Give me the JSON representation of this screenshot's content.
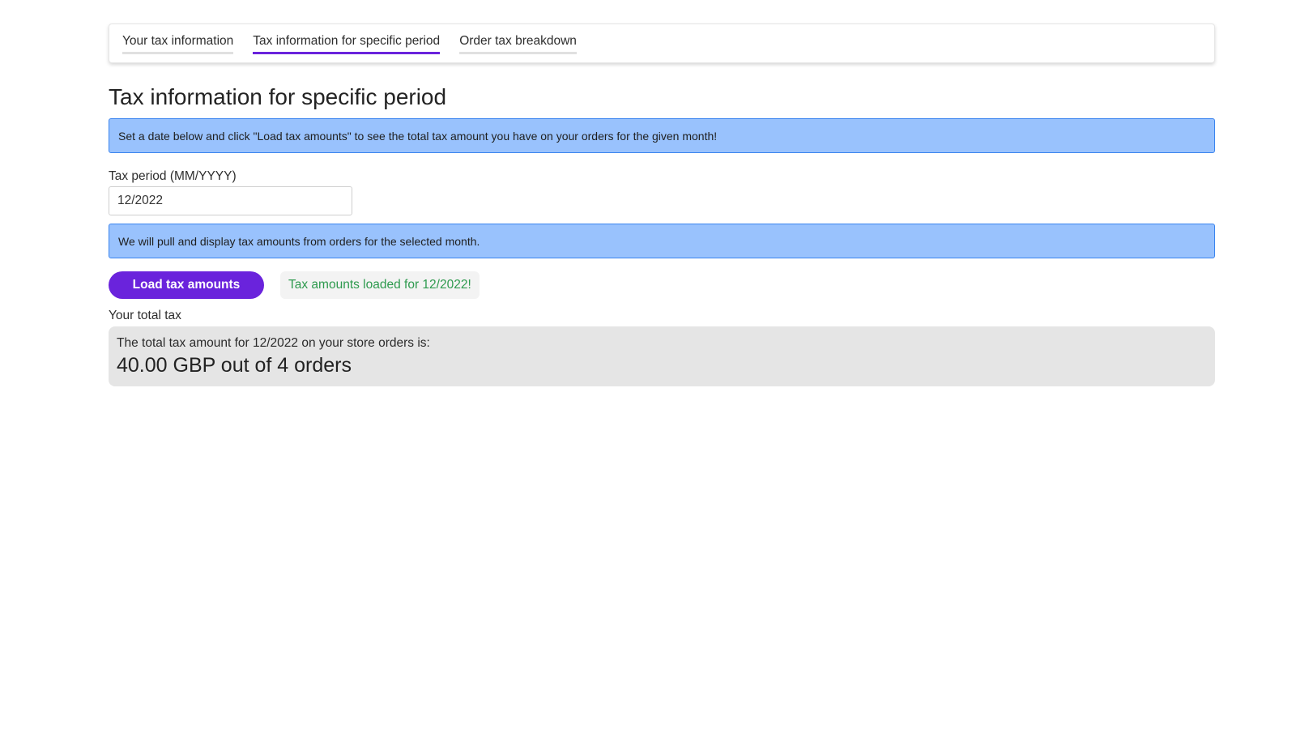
{
  "tabs": [
    {
      "label": "Your tax information",
      "active": false
    },
    {
      "label": "Tax information for specific period",
      "active": true
    },
    {
      "label": "Order tax breakdown",
      "active": false
    }
  ],
  "page_title": "Tax information for specific period",
  "intro_banner": "Set a date below and click \"Load tax amounts\" to see the total tax amount you have on your orders for the given month!",
  "period_field": {
    "label": "Tax period (MM/YYYY)",
    "value": "12/2022"
  },
  "pull_banner": "We will pull and display tax amounts from orders for the selected month.",
  "load_button_label": "Load tax amounts",
  "success_message": "Tax amounts loaded for 12/2022!",
  "total": {
    "label": "Your total tax",
    "description": "The total tax amount for 12/2022 on your store orders is:",
    "amount": "40.00 GBP out of 4 orders"
  },
  "colors": {
    "accent": "#6a23dc",
    "info_bg": "#99c2fd",
    "info_border": "#3a84ef",
    "success_text": "#2e9a4e",
    "total_bg": "#e5e5e5"
  }
}
